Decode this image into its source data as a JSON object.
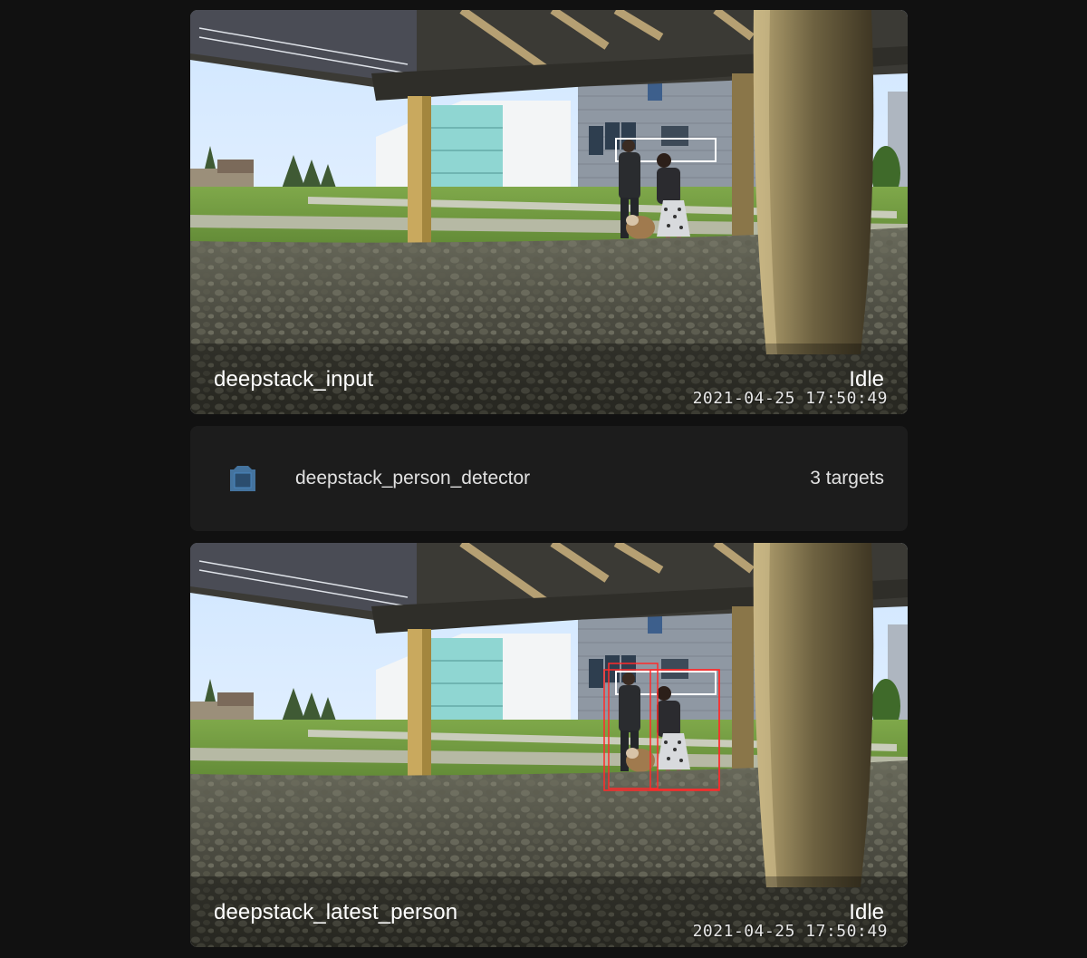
{
  "cameras": [
    {
      "name": "deepstack_input",
      "state": "Idle",
      "timestamp": "2021-04-25  17:50:49"
    },
    {
      "name": "deepstack_latest_person",
      "state": "Idle",
      "timestamp": "2021-04-25  17:50:49"
    }
  ],
  "entity": {
    "name": "deepstack_person_detector",
    "state": "3 targets",
    "icon": "image-filter-center-focus-icon",
    "icon_color": "#44739e"
  }
}
